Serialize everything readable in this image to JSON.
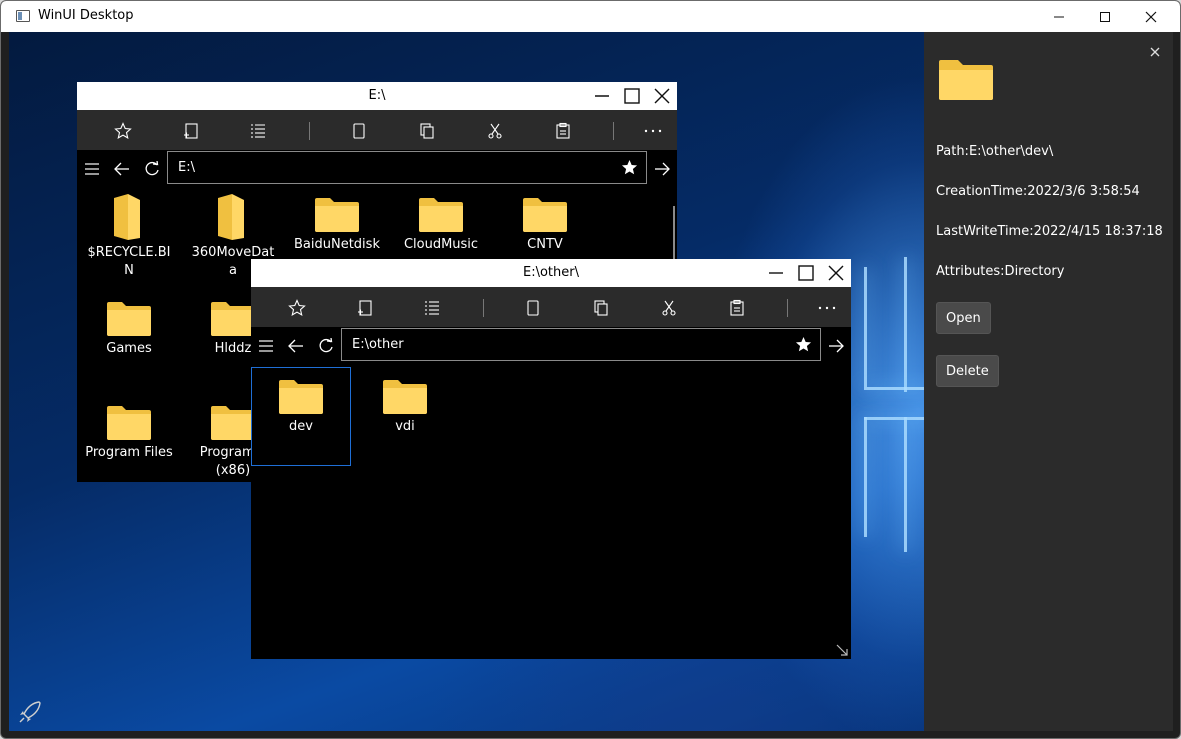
{
  "app": {
    "title": "WinUI Desktop"
  },
  "colors": {
    "folder": "#ffd766",
    "folder_back": "#f0c040",
    "selection": "#1f6fd6",
    "panel_bg": "#2b2b2b",
    "toolbar_bg": "#2b2b2b"
  },
  "icons": {
    "toolbar": [
      "star-icon",
      "new-item-icon",
      "list-icon",
      "blank-page-icon",
      "copy-icon",
      "cut-icon",
      "paste-icon",
      "more-icon"
    ],
    "nav": [
      "menu-icon",
      "back-icon",
      "refresh-icon",
      "favorite-star-icon",
      "go-arrow-icon"
    ],
    "side": [
      "close-icon",
      "folder-icon",
      "rocket-icon"
    ]
  },
  "back_window": {
    "title": "E:\\",
    "address": "E:\\",
    "items": [
      {
        "name": "$RECYCLE.BI\nN",
        "kind": "folder-open"
      },
      {
        "name": "360MoveDat\na",
        "kind": "folder-open"
      },
      {
        "name": "BaiduNetdisk",
        "kind": "folder"
      },
      {
        "name": "CloudMusic",
        "kind": "folder"
      },
      {
        "name": "CNTV",
        "kind": "folder"
      },
      {
        "name": "Games",
        "kind": "folder"
      },
      {
        "name": "Hlddz",
        "kind": "folder"
      },
      {
        "name": "Program Files",
        "kind": "folder"
      },
      {
        "name": "Program F\n(x86)",
        "kind": "folder"
      }
    ]
  },
  "front_window": {
    "title": "E:\\other\\",
    "address": "E:\\other",
    "items": [
      {
        "name": "dev",
        "selected": true
      },
      {
        "name": "vdi",
        "selected": false
      }
    ]
  },
  "details": {
    "path": "Path:E:\\other\\dev\\",
    "creation_time": "CreationTime:2022/3/6 3:58:54",
    "last_write_time": "LastWriteTime:2022/4/15 18:37:18",
    "attributes": "Attributes:Directory",
    "open_label": "Open",
    "delete_label": "Delete"
  }
}
